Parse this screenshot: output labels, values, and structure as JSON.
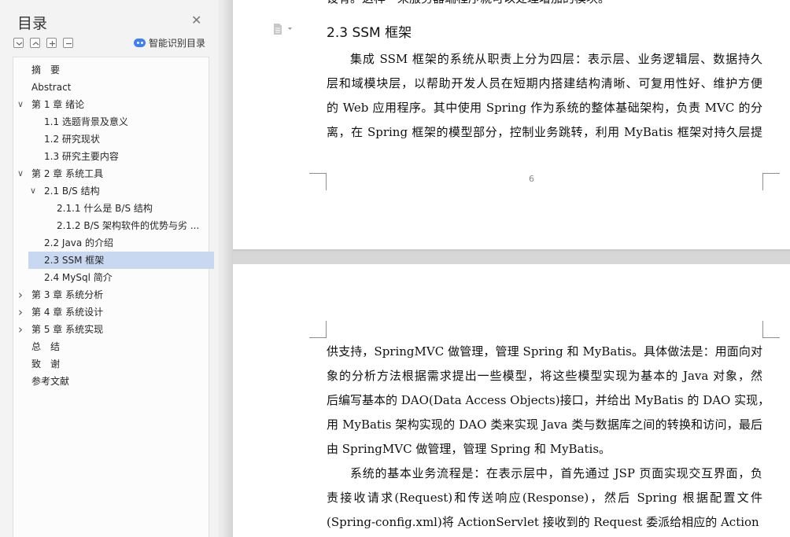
{
  "sidebar": {
    "title": "目录",
    "smart_toc_label": "智能识别目录",
    "toc": [
      {
        "label": "摘　要",
        "level": 0,
        "chevron": ""
      },
      {
        "label": "Abstract",
        "level": 0,
        "chevron": ""
      },
      {
        "label": "第 1 章  绪论",
        "level": 0,
        "chevron": "down"
      },
      {
        "label": "1.1  选题背景及意义",
        "level": 1,
        "chevron": ""
      },
      {
        "label": "1.2 研究现状",
        "level": 1,
        "chevron": ""
      },
      {
        "label": "1.3 研究主要内容",
        "level": 1,
        "chevron": ""
      },
      {
        "label": "第 2 章  系统工具",
        "level": 0,
        "chevron": "down"
      },
      {
        "label": "2.1 B/S 结构",
        "level": 1,
        "chevron": "down"
      },
      {
        "label": "2.1.1  什么是 B/S 结构",
        "level": 2,
        "chevron": ""
      },
      {
        "label": "2.1.2 B/S 架构软件的优势与劣 ...",
        "level": 2,
        "chevron": ""
      },
      {
        "label": "2.2 Java 的介绍",
        "level": 1,
        "chevron": ""
      },
      {
        "label": "2.3 SSM 框架",
        "level": 1,
        "chevron": "",
        "selected": true
      },
      {
        "label": "2.4 MySql 简介",
        "level": 1,
        "chevron": ""
      },
      {
        "label": "第 3 章  系统分析",
        "level": 0,
        "chevron": "right"
      },
      {
        "label": "第 4 章  系统设计",
        "level": 0,
        "chevron": "right"
      },
      {
        "label": "第 5 章  系统实现",
        "level": 0,
        "chevron": "right"
      },
      {
        "label": "总　结",
        "level": 0,
        "chevron": ""
      },
      {
        "label": "致　谢",
        "level": 0,
        "chevron": ""
      },
      {
        "label": "参考文献",
        "level": 0,
        "chevron": ""
      }
    ]
  },
  "document": {
    "top_cut_text": "设有。这样一来服务器端程序就可以处理增加的模块。",
    "heading": "2.3 SSM 框架",
    "page1_lines": [
      "集成 SSM 框架的系统从职责上分为四层：表示层、业务逻辑层、数据持久",
      "层和域模块层，以帮助开发人员在短期内搭建结构清晰、可复用性好、维护方便",
      "的 Web 应用程序。其中使用 Spring 作为系统的整体基础架构，负责 MVC 的分",
      "离，在 Spring 框架的模型部分，控制业务跳转，利用 MyBatis 框架对持久层提"
    ],
    "page_number": "6",
    "page2_lines": [
      "供支持，SpringMVC 做管理，管理 Spring 和 MyBatis。具体做法是：用面向对",
      "象的分析方法根据需求提出一些模型，将这些模型实现为基本的 Java 对象，然",
      "后编写基本的 DAO(Data Access Objects)接口，并给出 MyBatis 的 DAO 实现，采",
      "用 MyBatis 架构实现的 DAO 类来实现 Java 类与数据库之间的转换和访问，最后",
      "由 SpringMVC 做管理，管理 Spring 和 MyBatis。",
      "系统的基本业务流程是：在表示层中，首先通过 JSP 页面实现交互界面，负",
      "责接收请求(Request)和传送响应(Response)，然后 Spring 根据配置文件",
      "(Spring-config.xml)将 ActionServlet 接收到的 Request 委派给相应的 Action 处理。"
    ]
  }
}
